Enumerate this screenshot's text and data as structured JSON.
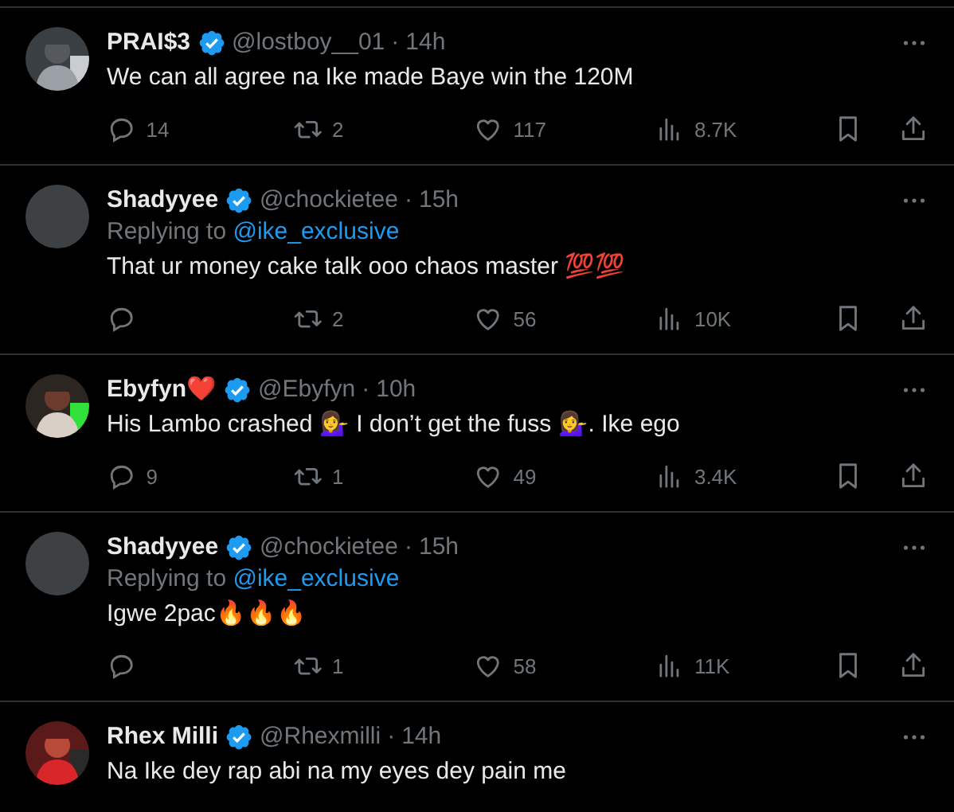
{
  "tweets": [
    {
      "name": "PRAI$3",
      "verified": true,
      "handle": "@lostboy__01",
      "separator": "·",
      "time": "14h",
      "text": "We can all agree na Ike made Baye win the 120M",
      "actions": {
        "replies": "14",
        "reposts": "2",
        "likes": "117",
        "views": "8.7K"
      }
    },
    {
      "avatar": {
        "kind": "blank"
      },
      "name": "Shadyyee",
      "verified": true,
      "handle": "@chockietee",
      "separator": "·",
      "time": "15h",
      "replying_to": {
        "label": "Replying to",
        "user": "@ike_exclusive"
      },
      "text": "That ur money cake talk ooo chaos master 💯💯",
      "actions": {
        "reposts": "2",
        "likes": "56",
        "views": "10K"
      }
    },
    {
      "name": "Ebyfyn❤️",
      "verified": true,
      "handle": "@Ebyfyn",
      "separator": "·",
      "time": "10h",
      "text": "His Lambo crashed 💁‍♀️ I don’t get the fuss 💁‍♀️. Ike ego",
      "actions": {
        "replies": "9",
        "reposts": "1",
        "likes": "49",
        "views": "3.4K"
      }
    },
    {
      "avatar": {
        "kind": "blank"
      },
      "name": "Shadyyee",
      "verified": true,
      "handle": "@chockietee",
      "separator": "·",
      "time": "15h",
      "replying_to": {
        "label": "Replying to",
        "user": "@ike_exclusive"
      },
      "text": "Igwe 2pac🔥🔥🔥",
      "actions": {
        "reposts": "1",
        "likes": "58",
        "views": "11K"
      }
    },
    {
      "name": "Rhex Milli",
      "verified": true,
      "handle": "@Rhexmilli",
      "separator": "·",
      "time": "14h",
      "text": "Na Ike dey rap abi na my eyes dey pain me"
    }
  ]
}
